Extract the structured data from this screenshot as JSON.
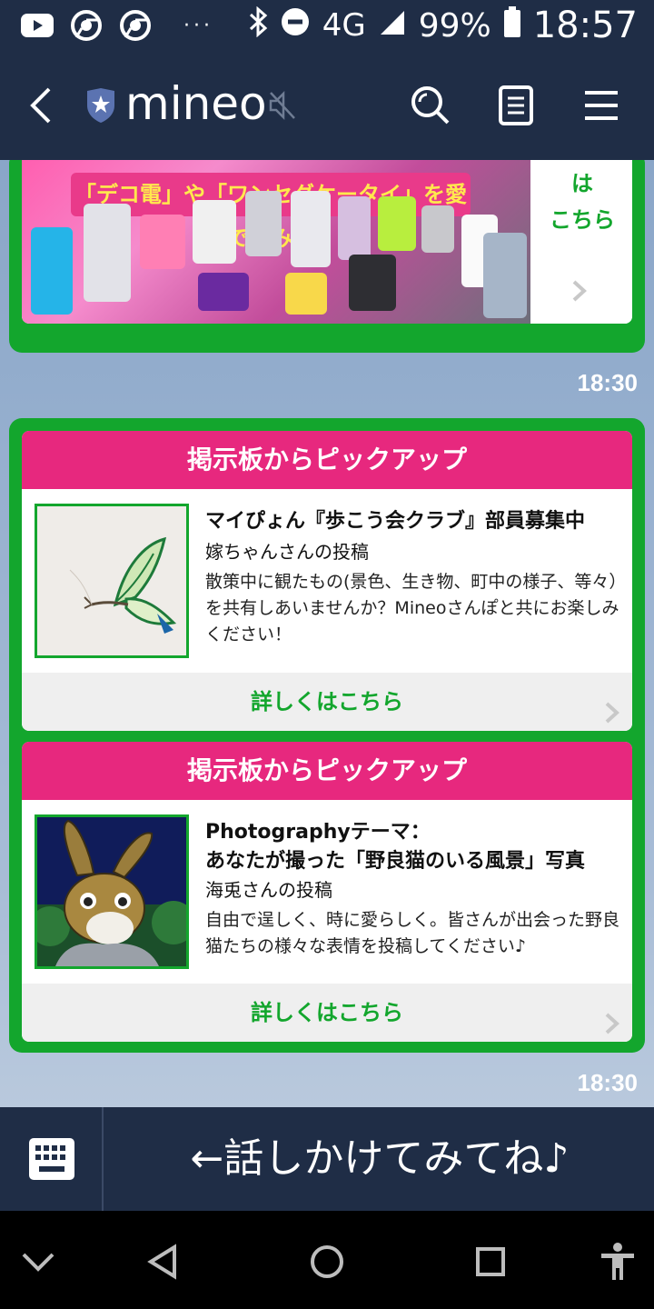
{
  "status_bar": {
    "icons": [
      "youtube-icon",
      "chrome-icon",
      "chrome-icon",
      "more-dots-icon",
      "bluetooth-icon",
      "do-not-disturb-icon",
      "signal-icon",
      "battery-icon"
    ],
    "dots": "···",
    "network": "4G",
    "battery": "99%",
    "time": "18:57"
  },
  "app_bar": {
    "title": "mineo",
    "icons": [
      "back-arrow-icon",
      "shield-star-icon",
      "mute-icon",
      "search-icon",
      "note-icon",
      "menu-icon"
    ]
  },
  "chat": {
    "banner": {
      "caption": "「デコ電」や「ワンセグケータイ」を愛でてみた",
      "link_text": "は\nこちら"
    },
    "banner_time": "18:30",
    "posts": [
      {
        "header": "掲示板からピックアップ",
        "title": "マイぴょん『歩こう会クラブ』部員募集中",
        "author": "嫁ちゃんさんの投稿",
        "description": "散策中に観たもの(景色、生き物、町中の様子、等々）を共有しあいませんか？Mineoさんぽと共にお楽しみください！",
        "more": "詳しくはこちら",
        "thumbnail": "butterfly-image"
      },
      {
        "header": "掲示板からピックアップ",
        "title": "Photographyテーマ：\nあなたが撮った「野良猫のいる風景」写真",
        "author": "海兎さんの投稿",
        "description": "自由で逞しく、時に愛らしく。皆さんが出会った野良猫たちの様々な表情を投稿してください♪",
        "more": "詳しくはこちら",
        "thumbnail": "rabbit-character-image"
      }
    ],
    "posts_time": "18:30"
  },
  "input_bar": {
    "prompt": "←話しかけてみてね♪",
    "icon": "keyboard-icon"
  },
  "nav_bar": {
    "icons": [
      "collapse-chevron-icon",
      "back-triangle-icon",
      "home-circle-icon",
      "recents-square-icon",
      "accessibility-icon"
    ]
  },
  "colors": {
    "bar": "#1f2d46",
    "bubble_green": "#13a62d",
    "header_pink": "#e7287e"
  }
}
